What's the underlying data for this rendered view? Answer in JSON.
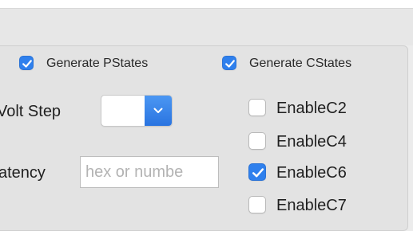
{
  "header": {
    "generate_pstates": {
      "label": "Generate PStates",
      "checked": true
    },
    "generate_cstates": {
      "label": "Generate CStates",
      "checked": true
    }
  },
  "settings": {
    "volt_step_label": "Volt Step",
    "volt_step_value": "",
    "latency_label": "atency",
    "latency_placeholder": "hex or numbe",
    "latency_value": ""
  },
  "cstates": [
    {
      "label": "EnableC2",
      "checked": false
    },
    {
      "label": "EnableC4",
      "checked": false
    },
    {
      "label": "EnableC6",
      "checked": true
    },
    {
      "label": "EnableC7",
      "checked": false
    }
  ],
  "colors": {
    "accent": "#2f80ed",
    "window_bg": "#ececec",
    "group_bg": "#e3e3e3"
  }
}
